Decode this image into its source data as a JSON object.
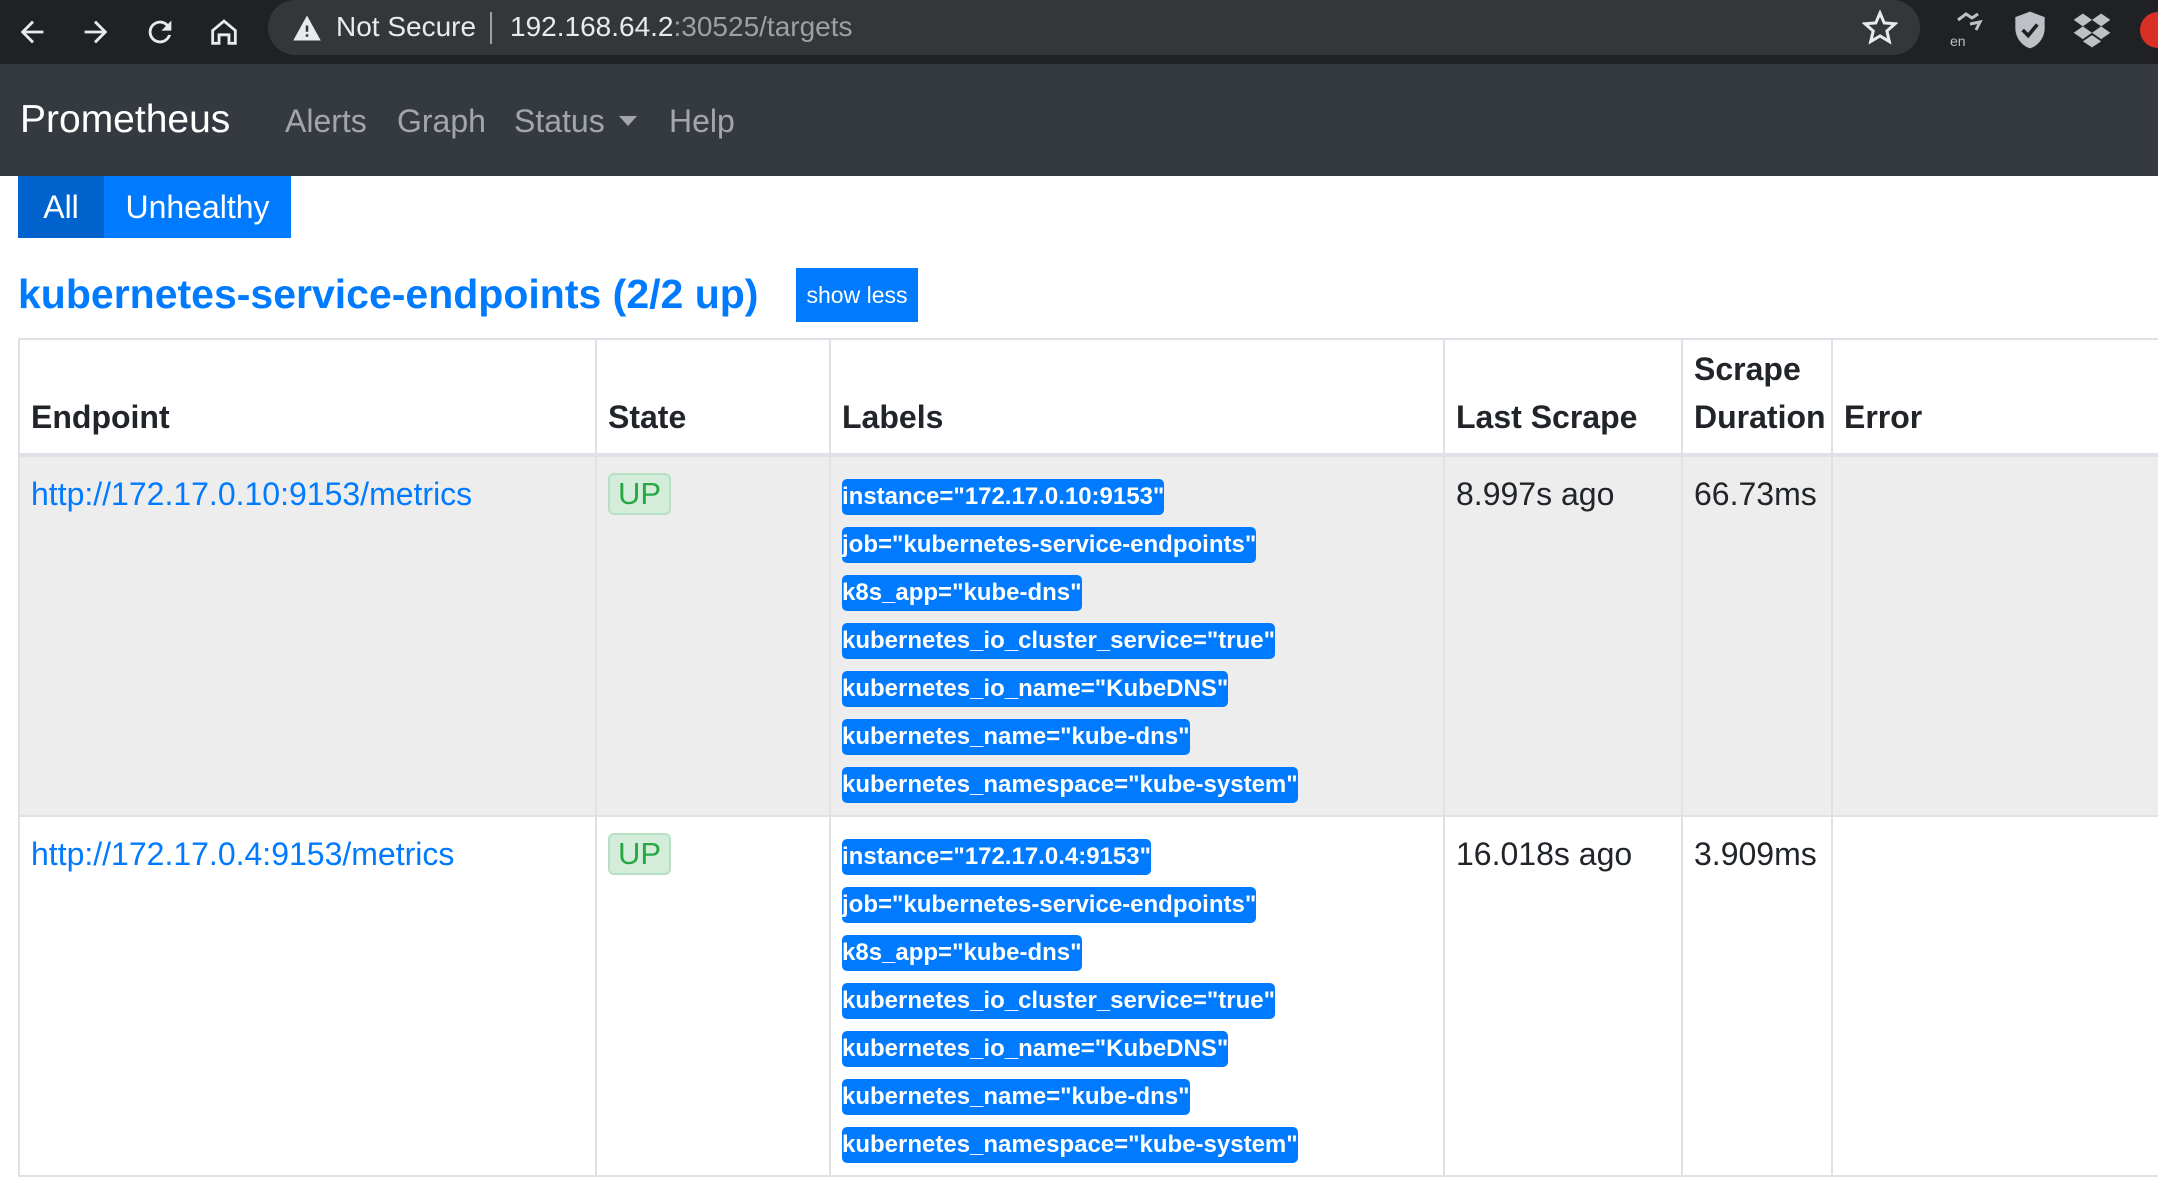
{
  "browser": {
    "security_label": "Not Secure",
    "url_host": "192.168.64.2",
    "url_rest": ":30525/targets",
    "extensions": [
      "translate-icon",
      "shield-extension-icon",
      "dropbox-icon",
      "profile-icon"
    ],
    "ext_translate_text": "en"
  },
  "navbar": {
    "brand": "Prometheus",
    "links": [
      "Alerts",
      "Graph",
      "Status",
      "Help"
    ]
  },
  "filters": {
    "all": "All",
    "unhealthy": "Unhealthy"
  },
  "job": {
    "title": "kubernetes-service-endpoints (2/2 up)",
    "toggle_label": "show less"
  },
  "table": {
    "headers": {
      "endpoint": "Endpoint",
      "state": "State",
      "labels": "Labels",
      "last_scrape": "Last Scrape",
      "scrape_duration_1": "Scrape",
      "scrape_duration_2": "Duration",
      "error": "Error"
    },
    "rows": [
      {
        "endpoint": "http://172.17.0.10:9153/metrics",
        "state": "UP",
        "labels": [
          "instance=\"172.17.0.10:9153\"",
          "job=\"kubernetes-service-endpoints\"",
          "k8s_app=\"kube-dns\"",
          "kubernetes_io_cluster_service=\"true\"",
          "kubernetes_io_name=\"KubeDNS\"",
          "kubernetes_name=\"kube-dns\"",
          "kubernetes_namespace=\"kube-system\""
        ],
        "last_scrape": "8.997s ago",
        "scrape_duration": "66.73ms",
        "error": ""
      },
      {
        "endpoint": "http://172.17.0.4:9153/metrics",
        "state": "UP",
        "labels": [
          "instance=\"172.17.0.4:9153\"",
          "job=\"kubernetes-service-endpoints\"",
          "k8s_app=\"kube-dns\"",
          "kubernetes_io_cluster_service=\"true\"",
          "kubernetes_io_name=\"KubeDNS\"",
          "kubernetes_name=\"kube-dns\"",
          "kubernetes_namespace=\"kube-system\""
        ],
        "last_scrape": "16.018s ago",
        "scrape_duration": "3.909ms",
        "error": ""
      }
    ]
  },
  "colors": {
    "accent": "#007bff",
    "navbar_bg": "#343a40",
    "up_green": "#28a745"
  }
}
